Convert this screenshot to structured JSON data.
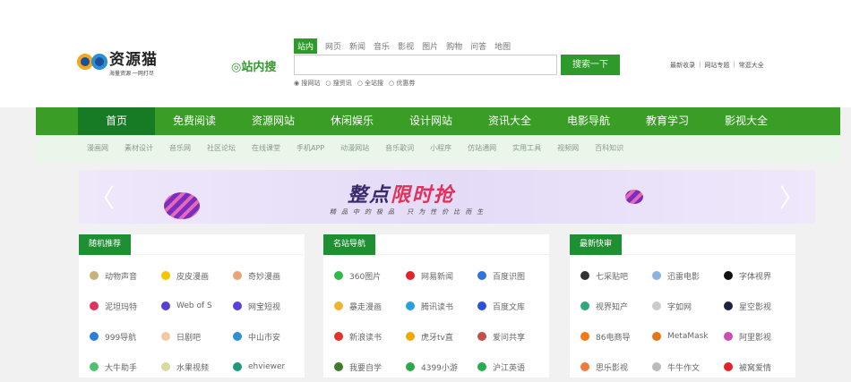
{
  "logo": {
    "title": "资源猫",
    "subtitle": "海量资源 一网打尽"
  },
  "search": {
    "brand": "站内搜",
    "tabs": [
      "站内",
      "网页",
      "新闻",
      "音乐",
      "影视",
      "图片",
      "购物",
      "问答",
      "地图"
    ],
    "placeholder": "",
    "button": "搜索一下",
    "radios": [
      "搜网站",
      "搜资讯",
      "全站搜",
      "优惠券"
    ],
    "selected_radio": "搜网站"
  },
  "quick_links": [
    "最新收录",
    "网站专题",
    "常逛大全"
  ],
  "nav": [
    "首页",
    "免费阅读",
    "资源网站",
    "休闲娱乐",
    "设计网站",
    "资讯大全",
    "电影导航",
    "教育学习",
    "影视大全"
  ],
  "subnav": [
    "漫画网",
    "素材设计",
    "音乐网",
    "社区论坛",
    "在线课堂",
    "手机APP",
    "动漫网站",
    "音乐歌词",
    "小程序",
    "仿站通网",
    "实用工具",
    "视频网",
    "百科知识"
  ],
  "banner": {
    "title_a": "整点",
    "title_b": "限时抢",
    "subtitle": "精品中的极品 只为性价比而生"
  },
  "cards": [
    {
      "title": "随机推荐",
      "items": [
        {
          "l": "动物声音",
          "c": "#c9b27a"
        },
        {
          "l": "皮皮漫画",
          "c": "#f3c400"
        },
        {
          "l": "奇妙漫画",
          "c": "#e8a57a"
        },
        {
          "l": "泥坦玛特",
          "c": "#e0335a"
        },
        {
          "l": "Web of S",
          "c": "#5b3fd1"
        },
        {
          "l": "网宝短视",
          "c": "#5a3fe0"
        },
        {
          "l": "999导航",
          "c": "#2a7fd6"
        },
        {
          "l": "日剧吧",
          "c": "#f3c9a0"
        },
        {
          "l": "中山市安",
          "c": "#2e8fd6"
        },
        {
          "l": "大牛助手",
          "c": "#4cc26e"
        },
        {
          "l": "水果视频",
          "c": "#d9d9a0"
        },
        {
          "l": "ehviewer",
          "c": "#1d9a7a"
        }
      ]
    },
    {
      "title": "名站导航",
      "items": [
        {
          "l": "360图片",
          "c": "#2fb94a"
        },
        {
          "l": "网易新闻",
          "c": "#e0252a"
        },
        {
          "l": "百度识图",
          "c": "#2f74e0"
        },
        {
          "l": "暴走漫画",
          "c": "#f0b430"
        },
        {
          "l": "腾讯读书",
          "c": "#2a9fe0"
        },
        {
          "l": "百度文库",
          "c": "#2e4fd6"
        },
        {
          "l": "新浪读书",
          "c": "#e0332a"
        },
        {
          "l": "虎牙tv直",
          "c": "#f3a800"
        },
        {
          "l": "爱问共享",
          "c": "#c0504d"
        },
        {
          "l": "我要自学",
          "c": "#3d7a2a"
        },
        {
          "l": "4399小游",
          "c": "#2ea84a"
        },
        {
          "l": "沪江英语",
          "c": "#22b04a"
        }
      ]
    },
    {
      "title": "最新快审",
      "items": [
        {
          "l": "七采贴吧",
          "c": "#333"
        },
        {
          "l": "迅雷电影",
          "c": "#8ab4e0"
        },
        {
          "l": "字体视界",
          "c": "#111"
        },
        {
          "l": "视界知产",
          "c": "#2fa87a"
        },
        {
          "l": "字如网",
          "c": "#ccc"
        },
        {
          "l": "星空影视",
          "c": "#1a2340"
        },
        {
          "l": "86电商导",
          "c": "#f07a1a"
        },
        {
          "l": "MetaMask",
          "c": "#e2761b"
        },
        {
          "l": "阿里影视",
          "c": "#c94fb0"
        },
        {
          "l": "思乐影视",
          "c": "#f07a3a"
        },
        {
          "l": "牛牛作文",
          "c": "#bbb"
        },
        {
          "l": "被窝爱情",
          "c": "#e0252a"
        }
      ]
    }
  ]
}
